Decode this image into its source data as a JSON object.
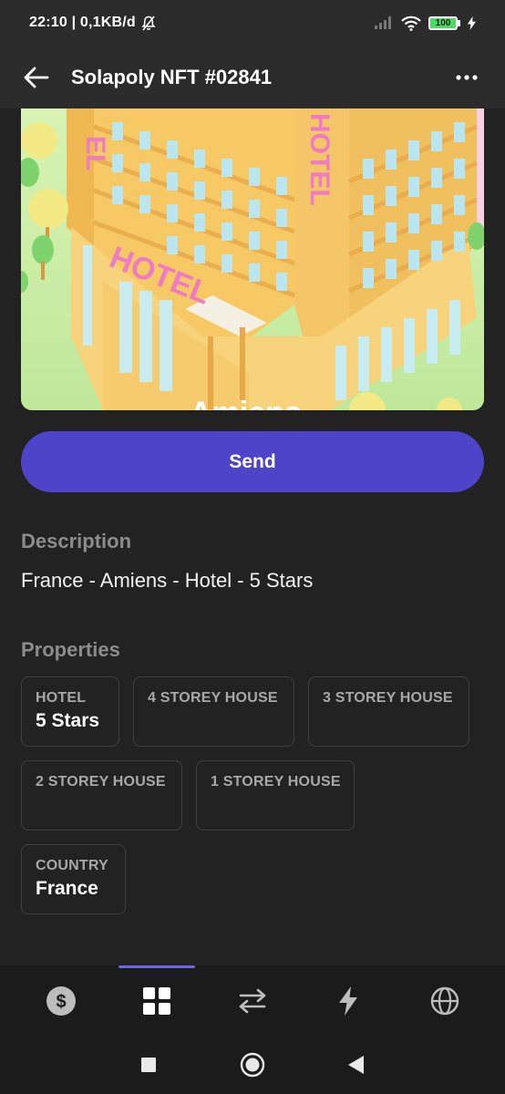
{
  "status_bar": {
    "time": "22:10 | 0,1KB/d",
    "battery_level": "100"
  },
  "app_bar": {
    "title": "Solapoly NFT #02841"
  },
  "nft_image": {
    "sign_main": "HOTEL",
    "sign_left": "EL",
    "sign_vertical": "HOTEL",
    "caption": "Amiens"
  },
  "send_button": {
    "label": "Send"
  },
  "description": {
    "heading": "Description",
    "text": "France - Amiens - Hotel - 5 Stars"
  },
  "properties": {
    "heading": "Properties",
    "items": [
      {
        "type": "HOTEL",
        "value": "5 Stars"
      },
      {
        "type": "4 STOREY HOUSE",
        "value": ""
      },
      {
        "type": "3 STOREY HOUSE",
        "value": ""
      },
      {
        "type": "2 STOREY HOUSE",
        "value": ""
      },
      {
        "type": "1 STOREY HOUSE",
        "value": ""
      },
      {
        "type": "COUNTRY",
        "value": "France"
      }
    ]
  },
  "bottom_nav": {
    "items": [
      {
        "icon": "dollar-icon",
        "active": false
      },
      {
        "icon": "grid-icon",
        "active": true
      },
      {
        "icon": "swap-icon",
        "active": false
      },
      {
        "icon": "lightning-icon",
        "active": false
      },
      {
        "icon": "globe-icon",
        "active": false
      }
    ]
  },
  "colors": {
    "accent": "#4d44c9",
    "background": "#222223",
    "nav_active": "#6d65e6"
  }
}
